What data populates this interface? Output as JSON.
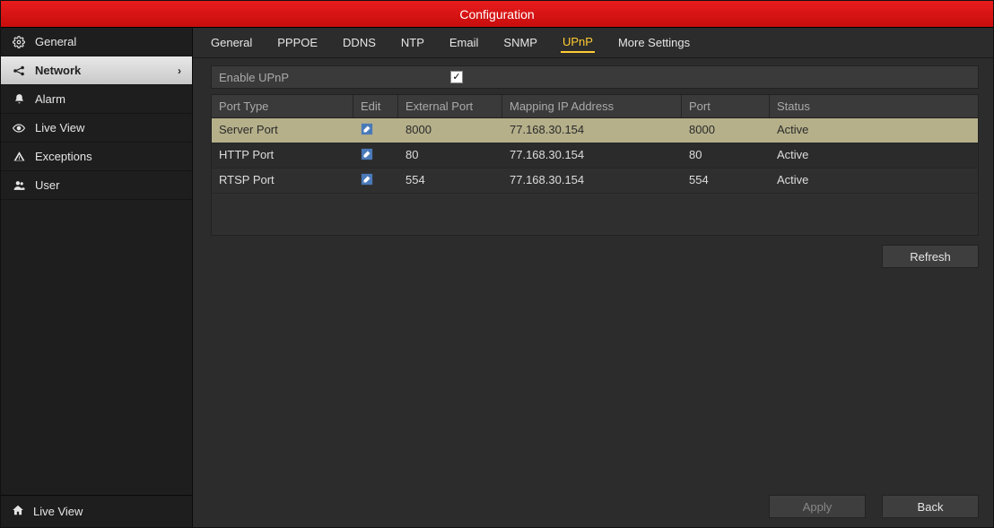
{
  "title": "Configuration",
  "sidebar": {
    "items": [
      {
        "icon": "gear",
        "label": "General",
        "name": "sidebar-item-general"
      },
      {
        "icon": "nodes",
        "label": "Network",
        "name": "sidebar-item-network",
        "active": true
      },
      {
        "icon": "bell",
        "label": "Alarm",
        "name": "sidebar-item-alarm"
      },
      {
        "icon": "eye",
        "label": "Live View",
        "name": "sidebar-item-live-view"
      },
      {
        "icon": "warn",
        "label": "Exceptions",
        "name": "sidebar-item-exceptions"
      },
      {
        "icon": "user",
        "label": "User",
        "name": "sidebar-item-user"
      }
    ],
    "footer": {
      "icon": "home",
      "label": "Live View"
    }
  },
  "tabs": [
    {
      "label": "General",
      "name": "tab-general"
    },
    {
      "label": "PPPOE",
      "name": "tab-pppoe"
    },
    {
      "label": "DDNS",
      "name": "tab-ddns"
    },
    {
      "label": "NTP",
      "name": "tab-ntp"
    },
    {
      "label": "Email",
      "name": "tab-email"
    },
    {
      "label": "SNMP",
      "name": "tab-snmp"
    },
    {
      "label": "UPnP",
      "name": "tab-upnp",
      "active": true
    },
    {
      "label": "More Settings",
      "name": "tab-more-settings"
    }
  ],
  "enable": {
    "label": "Enable UPnP",
    "checked": true
  },
  "table": {
    "headers": {
      "type": "Port Type",
      "edit": "Edit",
      "ext": "External Port",
      "ip": "Mapping IP Address",
      "port": "Port",
      "status": "Status"
    },
    "rows": [
      {
        "type": "Server Port",
        "ext": "8000",
        "ip": "77.168.30.154",
        "port": "8000",
        "status": "Active",
        "selected": true
      },
      {
        "type": "HTTP Port",
        "ext": "80",
        "ip": "77.168.30.154",
        "port": "80",
        "status": "Active"
      },
      {
        "type": "RTSP Port",
        "ext": "554",
        "ip": "77.168.30.154",
        "port": "554",
        "status": "Active"
      }
    ]
  },
  "buttons": {
    "refresh": "Refresh",
    "apply": "Apply",
    "back": "Back"
  }
}
